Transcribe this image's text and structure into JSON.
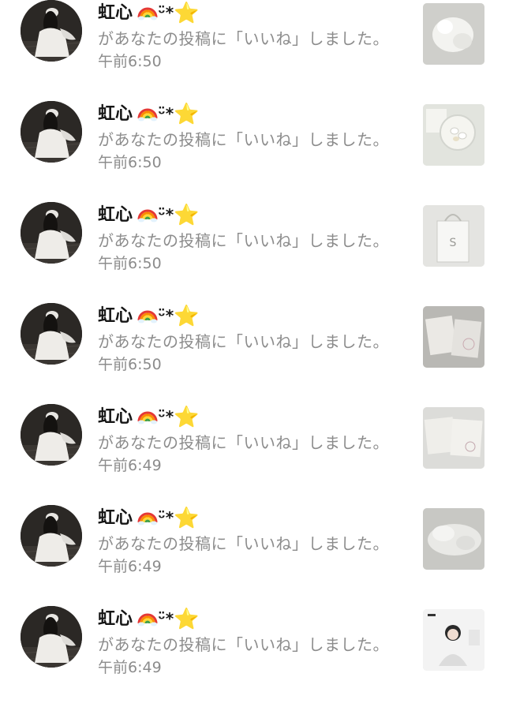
{
  "notifications": [
    {
      "user": "虹心",
      "message": "があなたの投稿に「いいね」しました。",
      "time": "午前6:50",
      "thumbnail": "fluffy-toy"
    },
    {
      "user": "虹心",
      "message": "があなたの投稿に「いいね」しました。",
      "time": "午前6:50",
      "thumbnail": "desk-items"
    },
    {
      "user": "虹心",
      "message": "があなたの投稿に「いいね」しました。",
      "time": "午前6:50",
      "thumbnail": "shopping-bag"
    },
    {
      "user": "虹心",
      "message": "があなたの投稿に「いいね」しました。",
      "time": "午前6:50",
      "thumbnail": "notebooks"
    },
    {
      "user": "虹心",
      "message": "があなたの投稿に「いいね」しました。",
      "time": "午前6:49",
      "thumbnail": "notebooks-2"
    },
    {
      "user": "虹心",
      "message": "があなたの投稿に「いいね」しました。",
      "time": "午前6:49",
      "thumbnail": "bedding"
    },
    {
      "user": "虹心",
      "message": "があなたの投稿に「いいね」しました。",
      "time": "午前6:49",
      "thumbnail": "portrait"
    }
  ],
  "name_decoration": {
    "kaomoji": "ᵕ̈*",
    "star": "⭐",
    "icons": [
      "rainbow-icon",
      "star-icon"
    ]
  },
  "colors": {
    "name": "#161616",
    "secondary_text": "#8c8c8c",
    "star": "#f5c518"
  }
}
